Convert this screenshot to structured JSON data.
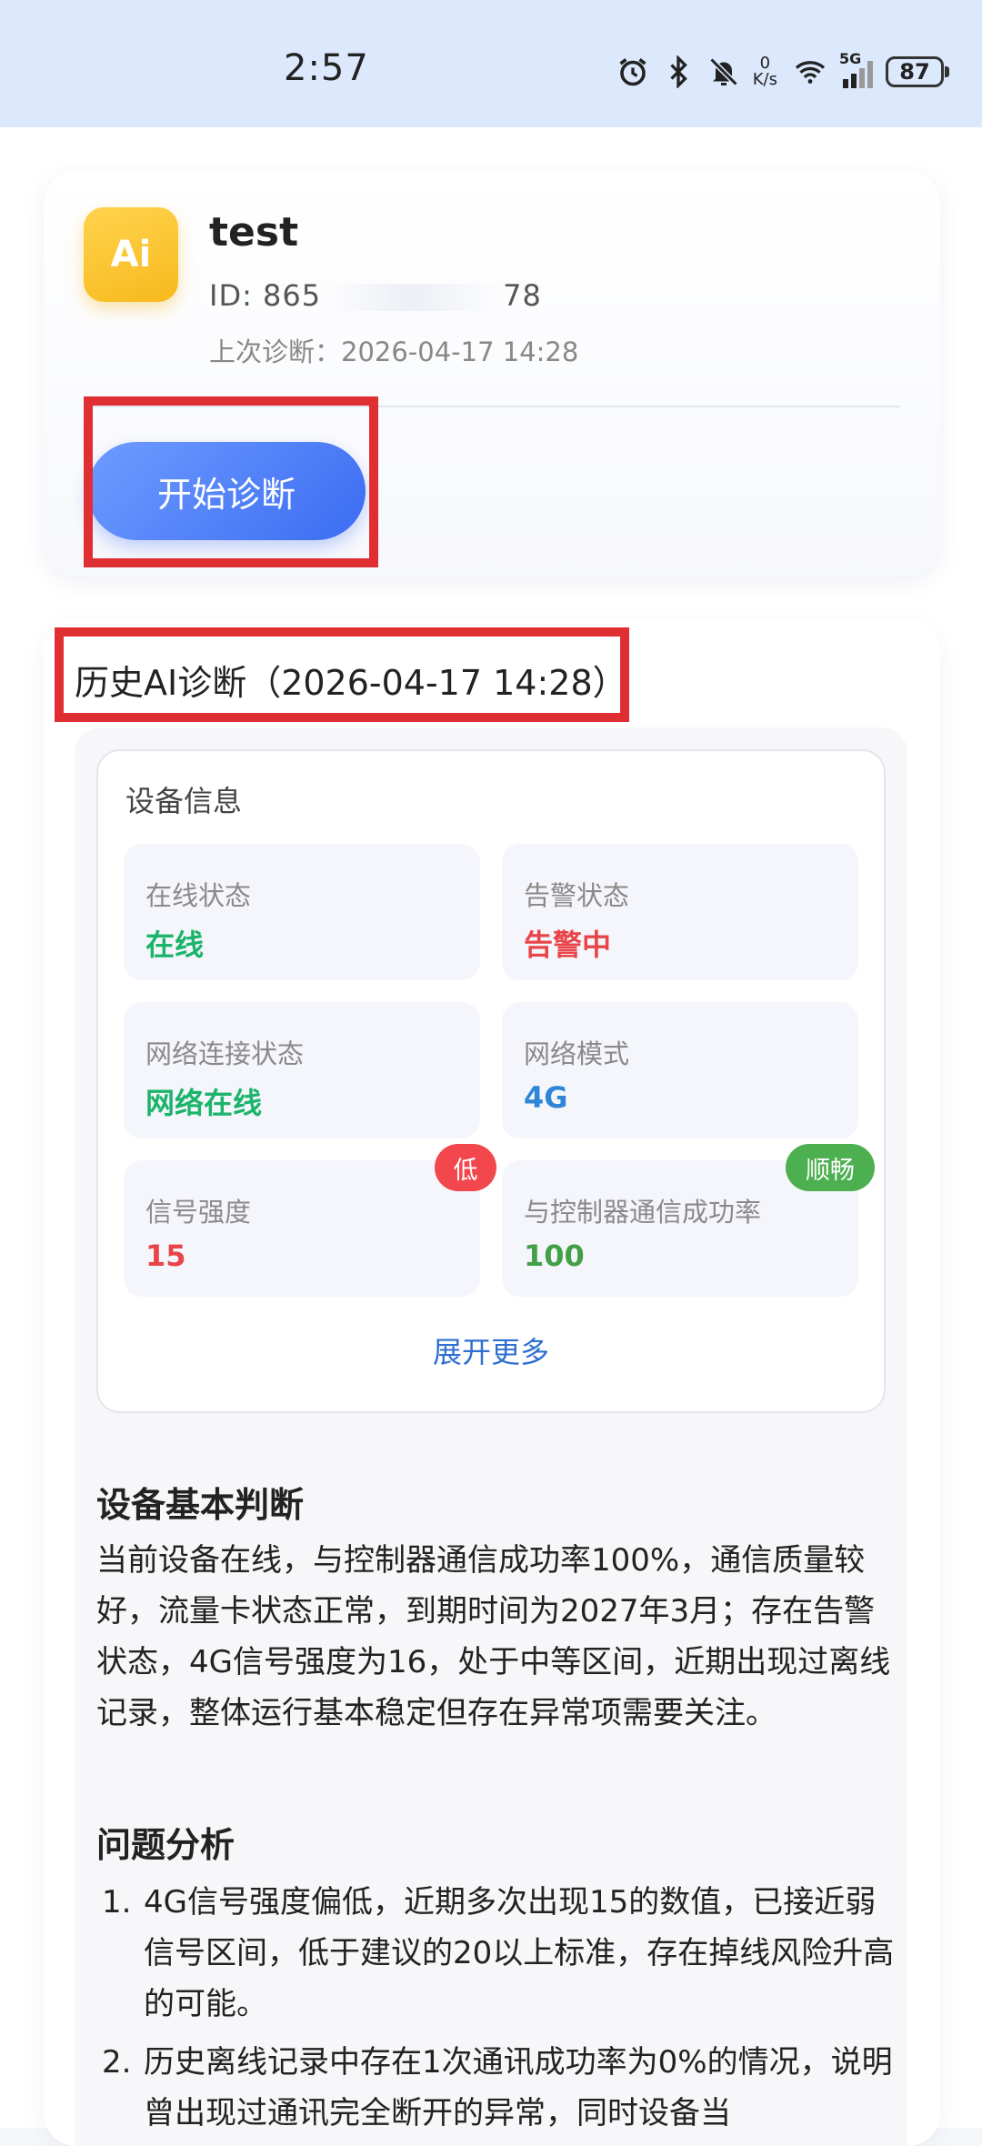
{
  "status_bar": {
    "time": "2:57",
    "net_speed_value": "0",
    "net_speed_unit": "K/s",
    "network_type": "5G",
    "battery": "87"
  },
  "device_card": {
    "avatar_text": "Ai",
    "name": "test",
    "id_prefix": "ID: 865",
    "id_suffix": "78",
    "last_diagnosis": "上次诊断：2026-04-17 14:28",
    "start_button": "开始诊断"
  },
  "history": {
    "title": "历史AI诊断（2026-04-17 14:28）",
    "device_info": {
      "title": "设备信息",
      "tiles": [
        {
          "label": "在线状态",
          "value": "在线",
          "value_color": "#1bb46a"
        },
        {
          "label": "告警状态",
          "value": "告警中",
          "value_color": "#e8454a"
        },
        {
          "label": "网络连接状态",
          "value": "网络在线",
          "value_color": "#1bb46a"
        },
        {
          "label": "网络模式",
          "value": "4G",
          "value_color": "#2f86d6"
        },
        {
          "label": "信号强度",
          "value": "15",
          "value_color": "#e8454a",
          "badge": "低",
          "badge_color": "#f2474c"
        },
        {
          "label": "与控制器通信成功率",
          "value": "100",
          "value_color": "#43a047",
          "badge": "顺畅",
          "badge_color": "#4caf50"
        }
      ],
      "expand": "展开更多"
    },
    "basic_judgement": {
      "heading": "设备基本判断",
      "text": "当前设备在线，与控制器通信成功率100%，通信质量较好，流量卡状态正常，到期时间为2027年3月；存在告警状态，4G信号强度为16，处于中等区间，近期出现过离线记录，整体运行基本稳定但存在异常项需要关注。"
    },
    "problem_analysis": {
      "heading": "问题分析",
      "items": [
        {
          "num": "1.",
          "text": "4G信号强度偏低，近期多次出现15的数值，已接近弱信号区间，低于建议的20以上标准，存在掉线风险升高的可能。"
        },
        {
          "num": "2.",
          "text": "历史离线记录中存在1次通讯成功率为0%的情况，说明曾出现过通讯完全断开的异常，同时设备当"
        }
      ]
    }
  }
}
